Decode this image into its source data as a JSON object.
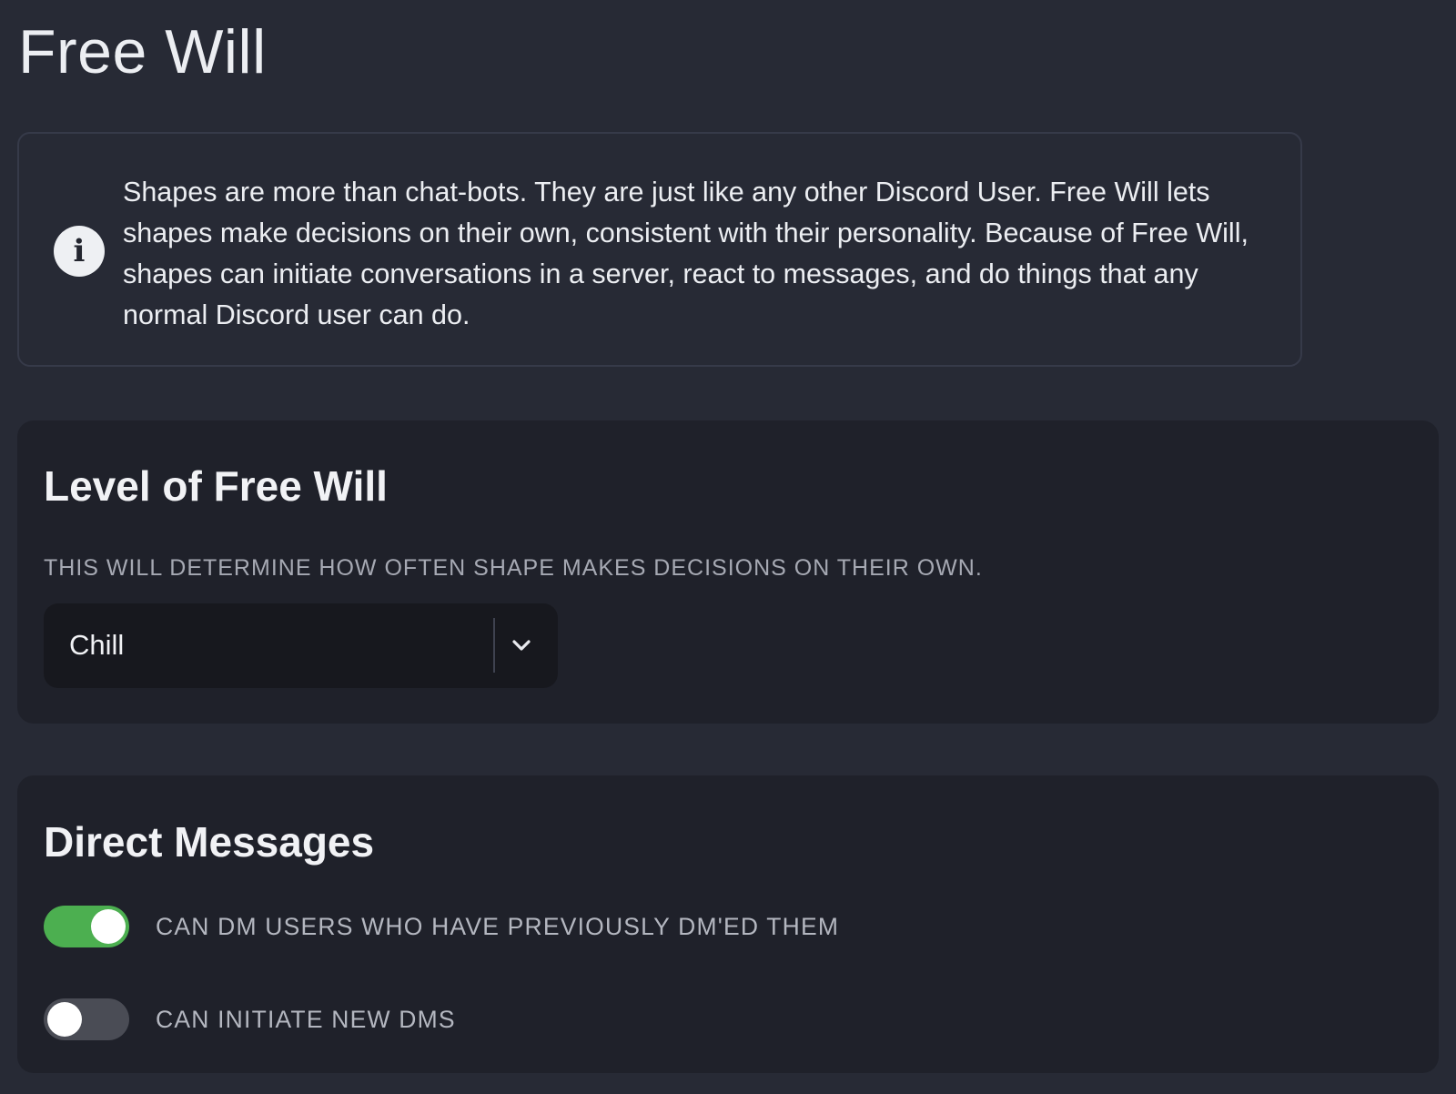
{
  "page": {
    "title": "Free Will"
  },
  "info": {
    "icon": "info-icon",
    "icon_glyph": "i",
    "text": "Shapes are more than chat-bots. They are just like any other Discord User. Free Will lets shapes make decisions on their own, consistent with their personality. Because of Free Will, shapes can initiate conversations in a server, react to messages, and do things that any normal Discord user can do."
  },
  "free_will_level": {
    "title": "Level of Free Will",
    "subtitle": "THIS WILL DETERMINE HOW OFTEN SHAPE MAKES DECISIONS ON THEIR OWN.",
    "select": {
      "value": "Chill",
      "icon": "chevron-down-icon"
    }
  },
  "direct_messages": {
    "title": "Direct Messages",
    "toggles": [
      {
        "label": "CAN DM USERS WHO HAVE PREVIOUSLY DM'ED THEM",
        "enabled": true
      },
      {
        "label": "CAN INITIATE NEW DMS",
        "enabled": false
      }
    ]
  },
  "colors": {
    "background": "#272a35",
    "card": "#1f212a",
    "select_bg": "#17181e",
    "toggle_on": "#4caf50",
    "toggle_off": "#4a4c55"
  }
}
